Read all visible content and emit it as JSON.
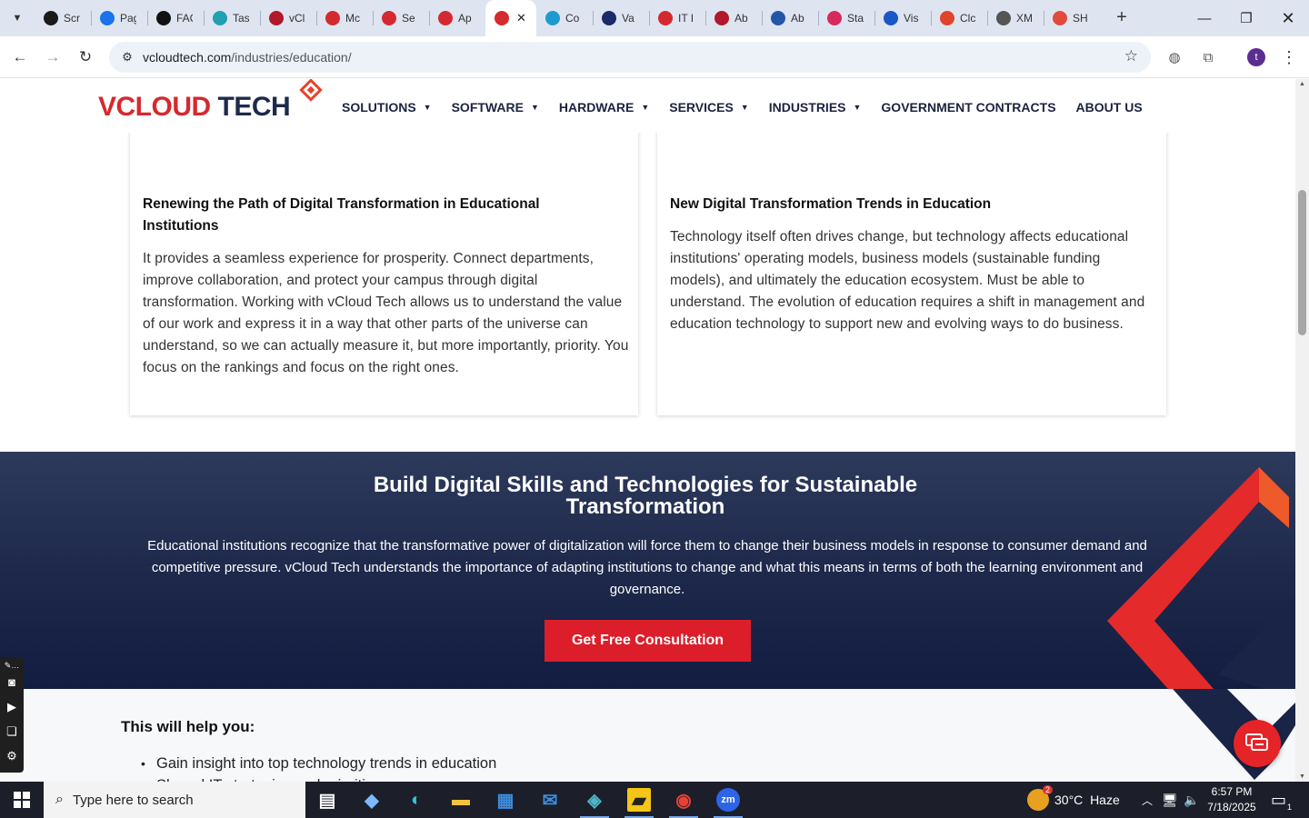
{
  "browser": {
    "tabs": [
      {
        "label": "Scr",
        "icon": "screencast-icon",
        "color": "#1a1a1a"
      },
      {
        "label": "Pag",
        "icon": "pagespeed-icon",
        "color": "#1a73e8"
      },
      {
        "label": "FAC",
        "icon": "openai-icon",
        "color": "#111111"
      },
      {
        "label": "Tas",
        "icon": "task-icon",
        "color": "#20a0b0"
      },
      {
        "label": "vCl",
        "icon": "vcloud-icon",
        "color": "#b0182b"
      },
      {
        "label": "Mc",
        "icon": "vcloud-diamond-icon",
        "color": "#d42a2f"
      },
      {
        "label": "Se",
        "icon": "vcloud-diamond-icon",
        "color": "#d42a2f"
      },
      {
        "label": "Ap",
        "icon": "vcloud-diamond-icon",
        "color": "#d42a2f"
      },
      {
        "label": "",
        "icon": "vcloud-diamond-icon",
        "color": "#d42a2f",
        "active": true
      },
      {
        "label": "Co",
        "icon": "copilot-icon",
        "color": "#1d9bd1"
      },
      {
        "label": "Va",
        "icon": "x-icon",
        "color": "#1b2a6b"
      },
      {
        "label": "IT I",
        "icon": "vcloud-diamond-icon",
        "color": "#d42a2f"
      },
      {
        "label": "Ab",
        "icon": "vcloud-small-icon",
        "color": "#b0182b"
      },
      {
        "label": "Ab",
        "icon": "scales-icon",
        "color": "#2456a8"
      },
      {
        "label": "Sta",
        "icon": "pen-icon",
        "color": "#d9285b"
      },
      {
        "label": "Vis",
        "icon": "pulse-icon",
        "color": "#1a58c8"
      },
      {
        "label": "Clc",
        "icon": "clc-icon",
        "color": "#e0442a"
      },
      {
        "label": "XM",
        "icon": "globe-icon",
        "color": "#555555"
      },
      {
        "label": "SH",
        "icon": "ring-icon",
        "color": "#e24a3b"
      }
    ],
    "url_host": "vcloudtech.com",
    "url_path": "/industries/education/",
    "profile_initial": "t"
  },
  "site": {
    "logo": {
      "v": "V",
      "cloud": "CLOUD",
      "tech": "TECH"
    },
    "nav": [
      {
        "label": "SOLUTIONS",
        "dropdown": true
      },
      {
        "label": "SOFTWARE",
        "dropdown": true
      },
      {
        "label": "HARDWARE",
        "dropdown": true
      },
      {
        "label": "SERVICES",
        "dropdown": true
      },
      {
        "label": "INDUSTRIES",
        "dropdown": true
      },
      {
        "label": "GOVERNMENT CONTRACTS",
        "dropdown": false
      },
      {
        "label": "ABOUT US",
        "dropdown": false
      }
    ],
    "cards": [
      {
        "title": "Renewing the Path of Digital Transformation in Educational Institutions",
        "body": "It provides a seamless experience for prosperity. Connect departments, improve collaboration, and protect your campus through digital transformation. Working with vCloud Tech allows us to understand the value of our work and express it in a way that other parts of the universe can understand, so we can actually measure it, but more importantly, priority. You focus on the rankings and focus on the right ones.",
        "icon": "chip-icon"
      },
      {
        "title": "New Digital Transformation Trends in Education",
        "body": "Technology itself often drives change, but technology affects educational institutions' operating models, business models (sustainable funding models), and ultimately the education ecosystem. Must be able to understand. The evolution of education requires a shift in management and education technology to support new and evolving ways to do business.",
        "icon": "globe-pen-icon"
      }
    ],
    "banner": {
      "title": "Build Digital Skills and Technologies for Sustainable Transformation",
      "text": "Educational institutions recognize that the transformative power of digitalization will force them to change their business models in response to consumer demand and competitive pressure. vCloud Tech understands the importance of adapting institutions to change and what this means in terms of both the learning environment and governance.",
      "cta": "Get Free Consultation"
    },
    "help": {
      "title": "This will help you:",
      "items": [
        "Gain insight into top technology trends in education",
        "Shared IT strategies and priorities"
      ]
    },
    "colors": {
      "brand_red": "#d42a2f",
      "navy": "#1c2749",
      "cta": "#dc1e2a"
    }
  },
  "taskbar": {
    "search_placeholder": "Type here to search",
    "weather_temp": "30°C",
    "weather_desc": "Haze",
    "weather_badge": "2",
    "time": "6:57 PM",
    "date": "7/18/2025",
    "notif_count": "1",
    "apps": [
      "task-view-icon",
      "copilot-icon",
      "edge-icon",
      "file-explorer-icon",
      "store-icon",
      "mail-icon",
      "app-diamond-icon",
      "sticky-notes-icon",
      "chrome-icon",
      "zoom-icon"
    ]
  }
}
